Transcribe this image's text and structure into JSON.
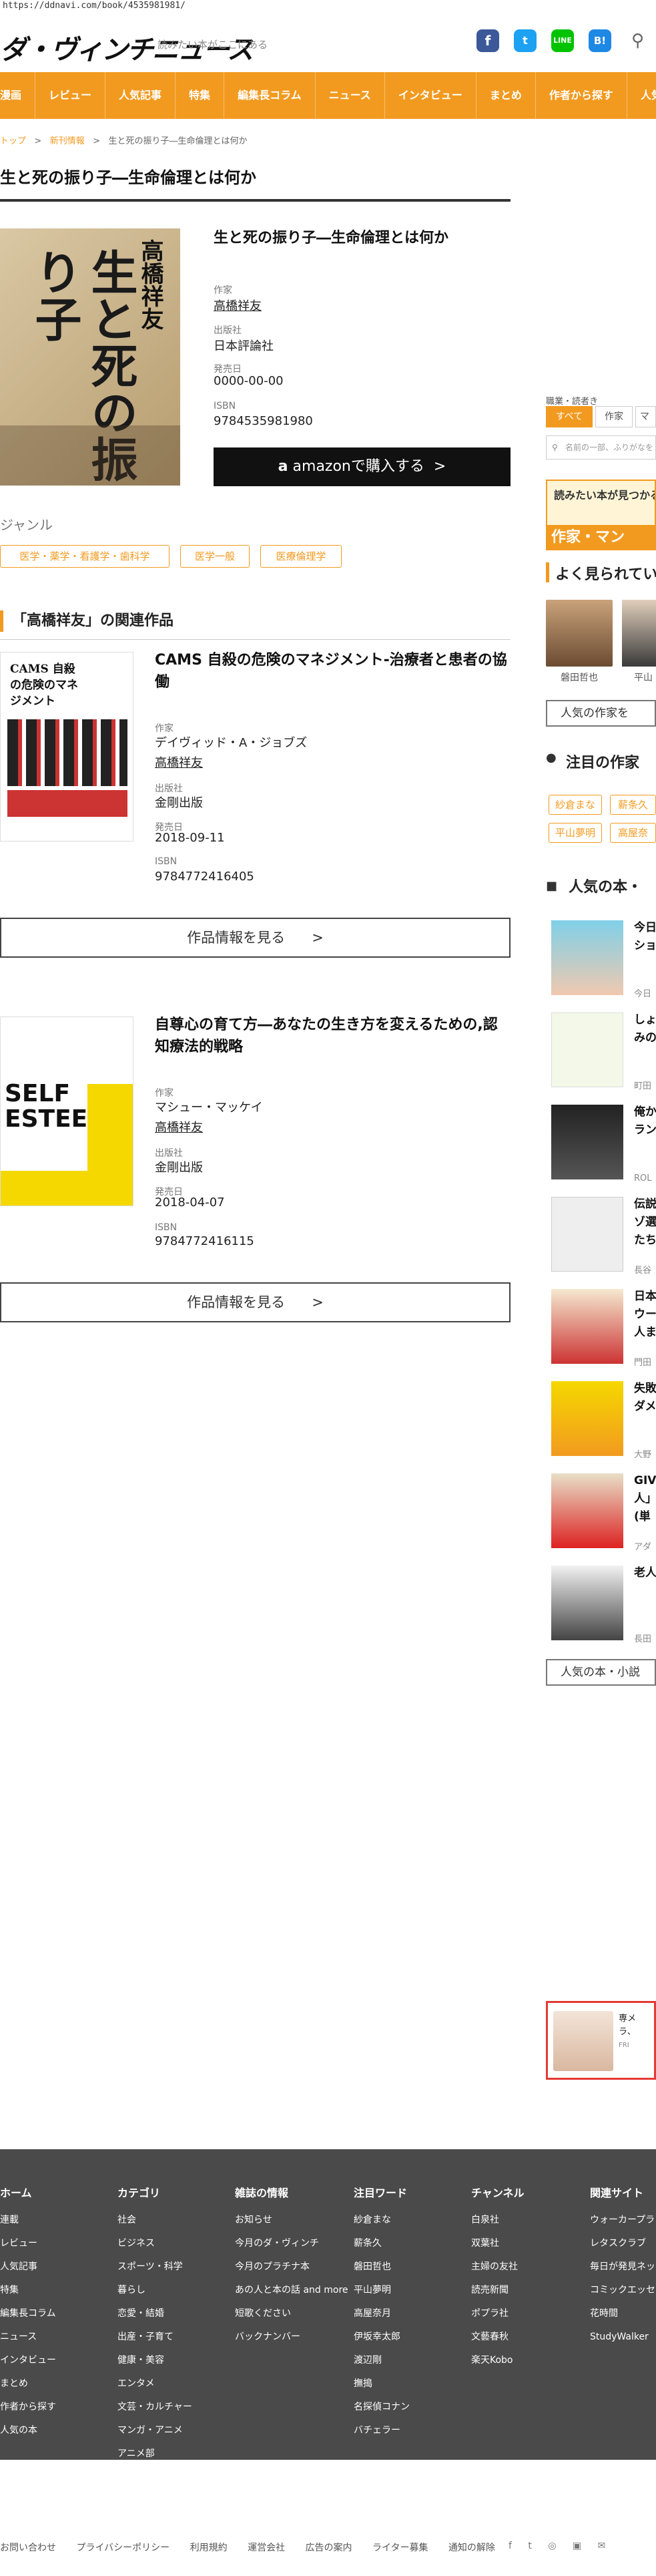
{
  "url": "https://ddnavi.com/book/4535981981/",
  "header": {
    "logo": "ダ・ヴィンチニュース",
    "tagline": "読みたい本がここにある"
  },
  "nav": [
    "漫画",
    "レビュー",
    "人気記事",
    "特集",
    "編集長コラム",
    "ニュース",
    "インタビュー",
    "まとめ",
    "作者から探す",
    "人気の本"
  ],
  "breadcrumb": {
    "home": "トップ",
    "sep": ">",
    "cat": "新刊情報",
    "current": "生と死の振り子―生命倫理とは何か"
  },
  "page_title": "生と死の振り子―生命倫理とは何か",
  "book": {
    "title": "生と死の振り子―生命倫理とは何か",
    "cover_text": "生と死の振り子",
    "cover_author": "高橋祥友",
    "author_label": "作家",
    "author": "高橋祥友",
    "publisher_label": "出版社",
    "publisher": "日本評論社",
    "date_label": "発売日",
    "date": "0000-00-00",
    "isbn_label": "ISBN",
    "isbn": "9784535981980",
    "amazon": "amazonで購入する"
  },
  "genre": {
    "label": "ジャンル",
    "tags": [
      "医学・薬学・看護学・歯科学",
      "医学一般",
      "医療倫理学"
    ]
  },
  "related": {
    "heading": "「高橋祥友」の関連作品",
    "items": [
      {
        "title": "CAMS 自殺の危険のマネジメント-治療者と患者の協働",
        "cover_title": "CAMS 自殺の危険のマネジメント",
        "author_label": "作家",
        "author": "デイヴィッド・A・ジョブズ",
        "translator": "高橋祥友",
        "publisher_label": "出版社",
        "publisher": "金剛出版",
        "date_label": "発売日",
        "date": "2018-09-11",
        "isbn_label": "ISBN",
        "isbn": "9784772416405",
        "button": "作品情報を見る"
      },
      {
        "title": "自尊心の育て方―あなたの生き方を変えるための,認知療法的戦略",
        "cover_title": "SELF ESTEEM",
        "author_label": "作家",
        "author": "マシュー・マッケイ",
        "translator": "高橋祥友",
        "publisher_label": "出版社",
        "publisher": "金剛出版",
        "date_label": "発売日",
        "date": "2018-04-07",
        "isbn_label": "ISBN",
        "isbn": "9784772416115",
        "button": "作品情報を見る"
      }
    ]
  },
  "sidebar": {
    "search_label": "職業・読者き",
    "tabs": [
      "すべて",
      "作家",
      "マ"
    ],
    "search_placeholder": "名前の一部、ふりがなを",
    "banner_top": "読みたい本が見つかるラ",
    "banner_bottom": "作家・マン",
    "popular_heading": "よく見られてい",
    "popular_people": [
      "磐田哲也",
      "平山"
    ],
    "popular_more": "人気の作家を",
    "featured_heading": "注目の作家",
    "featured_tags": [
      "紗倉まな",
      "薪条久",
      "平山夢明",
      "高屋奈"
    ],
    "books_heading": "人気の本・",
    "rank": [
      {
        "title": "今日",
        "title2": "ショ",
        "author": "今日"
      },
      {
        "title": "しょ",
        "title2": "みの",
        "author": "町田"
      },
      {
        "title": "俺か",
        "title2": "ラン",
        "author": "ROL"
      },
      {
        "title": "伝説",
        "title2": "ゾ選",
        "title3": "たち",
        "author": "長谷"
      },
      {
        "title": "日本",
        "title2": "ウー",
        "title3": "人ま",
        "author": "門田"
      },
      {
        "title": "失敗",
        "title2": "ダメ",
        "author": "大野"
      },
      {
        "title": "GIV",
        "title2": "人」",
        "title3": "(単",
        "author": "アダ"
      },
      {
        "title": "老人",
        "author": "長田"
      }
    ],
    "books_more": "人気の本・小説",
    "ad_line1": "専メ",
    "ad_line2": "ラ、",
    "ad_line3": "FRI"
  },
  "footer": {
    "cols": [
      {
        "h": "ホーム",
        "items": [
          "連載",
          "レビュー",
          "人気記事",
          "特集",
          "編集長コラム",
          "ニュース",
          "インタビュー",
          "まとめ",
          "作者から探す",
          "人気の本"
        ]
      },
      {
        "h": "カテゴリ",
        "items": [
          "社会",
          "ビジネス",
          "スポーツ・科学",
          "暮らし",
          "恋愛・結婚",
          "出産・子育て",
          "健康・美容",
          "エンタメ",
          "文芸・カルチャー",
          "マンガ・アニメ",
          "アニメ部"
        ]
      },
      {
        "h": "雑誌の情報",
        "items": [
          "お知らせ",
          "今月のダ・ヴィンチ",
          "今月のプラチナ本",
          "あの人と本の話 and more",
          "短歌ください",
          "バックナンバー"
        ]
      },
      {
        "h": "注目ワード",
        "items": [
          "紗倉まな",
          "薪条久",
          "磐田哲也",
          "平山夢明",
          "高屋奈月",
          "伊坂幸太郎",
          "渡辺剛",
          "撫搗",
          "名探偵コナン",
          "バチェラー"
        ]
      },
      {
        "h": "チャンネル",
        "items": [
          "白泉社",
          "双葉社",
          "主婦の友社",
          "読売新聞",
          "ポプラ社",
          "文藝春秋",
          "楽天Kobo"
        ]
      },
      {
        "h": "関連サイト",
        "items": [
          "ウォーカープラ",
          "レタスクラブ",
          "毎日が発見ネッ",
          "コミックエッセ",
          "花時間",
          "StudyWalker"
        ]
      }
    ]
  },
  "bottom_links": [
    "お問い合わせ",
    "プライバシーポリシー",
    "利用規約",
    "運営会社",
    "広告の案内",
    "ライター募集",
    "通知の解除"
  ],
  "colors": {
    "accent": "#f29a1f",
    "footer_bg": "#4a4a4a"
  }
}
